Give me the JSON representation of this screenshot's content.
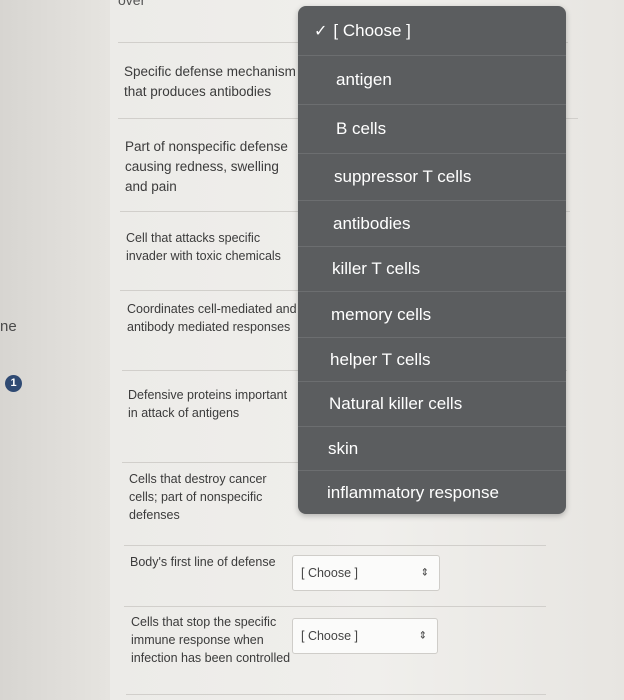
{
  "page": {
    "top_fragment": "over",
    "side_text": "ne",
    "side_badge": "1"
  },
  "questions": [
    {
      "text": "Specific defense mechanism that produces antibodies"
    },
    {
      "text": "Part of nonspecific defense causing redness, swelling and pain"
    },
    {
      "text": "Cell that attacks specific invader with toxic chemicals"
    },
    {
      "text": "Coordinates cell-mediated and antibody mediated responses"
    },
    {
      "text": "Defensive proteins important in attack of antigens"
    },
    {
      "text": "Cells that destroy cancer cells; part of nonspecific defenses"
    },
    {
      "text": "Body's first line of defense",
      "select_value": "[ Choose ]"
    },
    {
      "text": "Cells that stop the specific immune response when infection has been controlled",
      "select_value": "[ Choose ]"
    }
  ],
  "dropdown": {
    "check_icon": "✓",
    "options": [
      {
        "label": "[ Choose ]",
        "selected": true
      },
      {
        "label": "antigen"
      },
      {
        "label": "B cells"
      },
      {
        "label": "suppressor T cells"
      },
      {
        "label": "antibodies"
      },
      {
        "label": "killer T cells"
      },
      {
        "label": "memory cells"
      },
      {
        "label": "helper T cells"
      },
      {
        "label": "Natural killer cells"
      },
      {
        "label": "skin"
      },
      {
        "label": "inflammatory response"
      }
    ]
  },
  "colors": {
    "dropdown_bg": "#5b5d5f",
    "badge": "#2f4a73"
  }
}
